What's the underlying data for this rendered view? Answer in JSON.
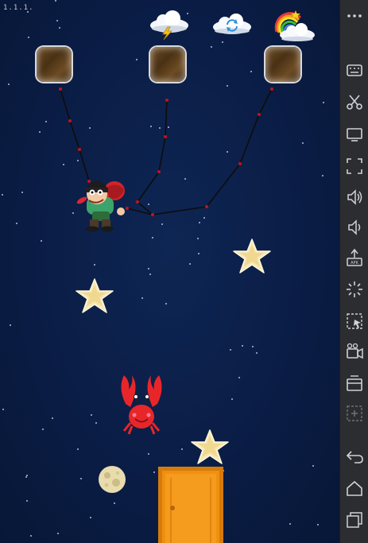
{
  "fps_counter": "1.1.1.",
  "toolbar": [
    {
      "name": "weather-lightning-button",
      "icon": "cloud-lightning-icon"
    },
    {
      "name": "restart-button",
      "icon": "cloud-refresh-icon"
    },
    {
      "name": "rainbow-button",
      "icon": "cloud-rainbow-icon"
    }
  ],
  "side_bar": [
    "vibrate-icon",
    "keyboard-icon",
    "scissors-icon",
    "display-icon",
    "fullscreen-icon",
    "volume-up-icon",
    "volume-down-icon",
    "apk-install-icon",
    "loading-icon",
    "screenshot-icon",
    "video-record-icon",
    "multi-window-icon",
    "add-icon",
    "back-icon",
    "home-icon",
    "recents-icon"
  ],
  "colors": {
    "sky": "#0b1d45",
    "rope": "#111111",
    "rope_knot": "#c0141c",
    "star": "#f3e5b0",
    "door": "#e88a10",
    "crab": "#e8262a",
    "sidebar": "#2b2d31"
  }
}
